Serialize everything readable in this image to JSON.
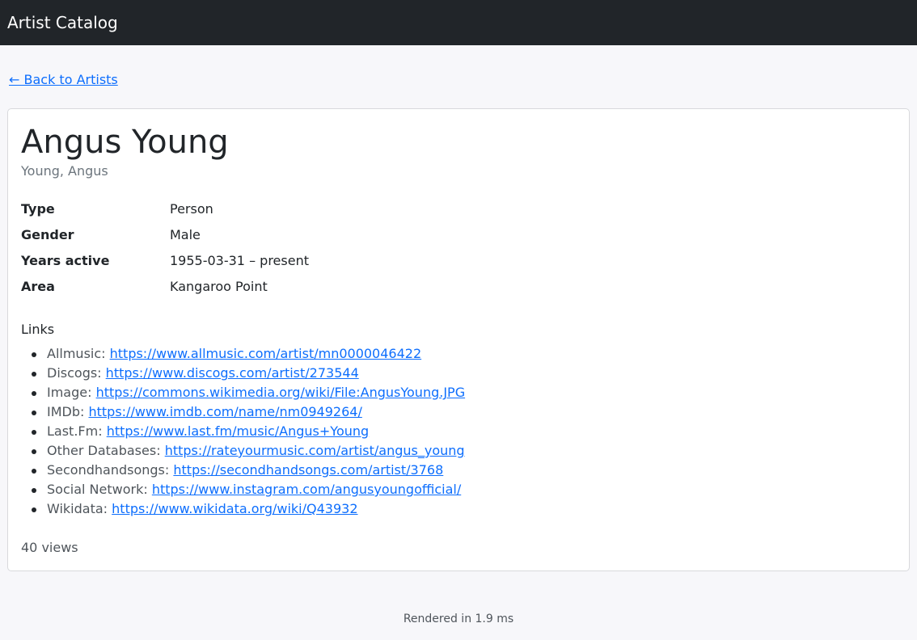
{
  "header": {
    "brand": "Artist Catalog"
  },
  "nav": {
    "back_label": "← Back to Artists"
  },
  "artist": {
    "name": "Angus Young",
    "sort_name": "Young, Angus",
    "attributes": [
      {
        "label": "Type",
        "value": "Person"
      },
      {
        "label": "Gender",
        "value": "Male"
      },
      {
        "label": "Years active",
        "value": "1955-03-31 – present"
      },
      {
        "label": "Area",
        "value": "Kangaroo Point"
      }
    ],
    "links_heading": "Links",
    "links": [
      {
        "site": "Allmusic:",
        "url": "https://www.allmusic.com/artist/mn0000046422"
      },
      {
        "site": "Discogs:",
        "url": "https://www.discogs.com/artist/273544"
      },
      {
        "site": "Image:",
        "url": "https://commons.wikimedia.org/wiki/File:AngusYoung.JPG"
      },
      {
        "site": "IMDb:",
        "url": "https://www.imdb.com/name/nm0949264/"
      },
      {
        "site": "Last.Fm:",
        "url": "https://www.last.fm/music/Angus+Young"
      },
      {
        "site": "Other Databases:",
        "url": "https://rateyourmusic.com/artist/angus_young"
      },
      {
        "site": "Secondhandsongs:",
        "url": "https://secondhandsongs.com/artist/3768"
      },
      {
        "site": "Social Network:",
        "url": "https://www.instagram.com/angusyoungofficial/"
      },
      {
        "site": "Wikidata:",
        "url": "https://www.wikidata.org/wiki/Q43932"
      }
    ],
    "views": "40 views"
  },
  "footer": {
    "render_time": "Rendered in 1.9 ms"
  }
}
